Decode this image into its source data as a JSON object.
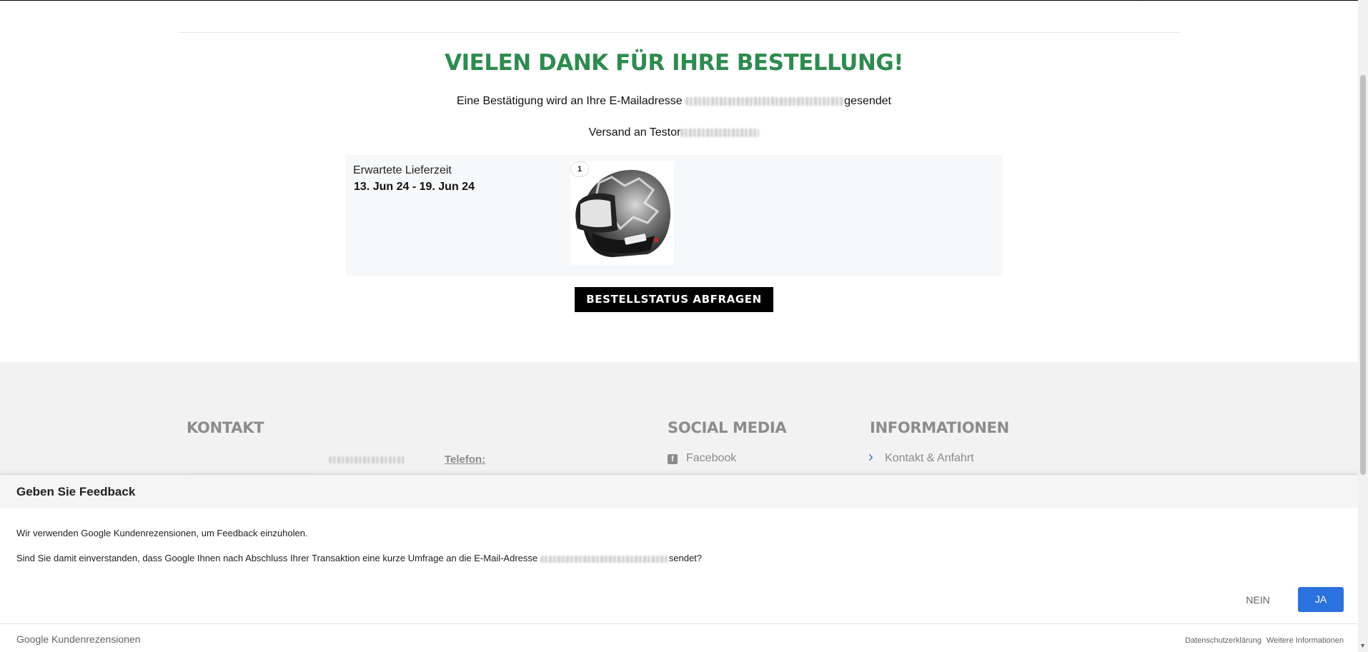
{
  "header": {
    "top_icons": [
      "person-icon",
      "cart-icon"
    ]
  },
  "confirmation": {
    "title": "VIELEN DANK FÜR IHRE BESTELLUNG!",
    "email_prefix": "Eine Bestätigung wird an Ihre E-Mailadresse",
    "email_suffix": "gesendet",
    "shipping_prefix": "Versand an Testor"
  },
  "order": {
    "delivery_label": "Erwartete Lieferzeit",
    "delivery_dates": "13. Jun 24 - 19. Jun 24",
    "item_quantity": "1",
    "status_button": "BESTELLSTATUS ABFRAGEN"
  },
  "footer": {
    "kontakt_heading": "KONTAKT",
    "phone_label": "Telefon:",
    "social_heading": "SOCIAL MEDIA",
    "facebook_label": "Facebook",
    "info_heading": "INFORMATIONEN",
    "info_link": "Kontakt & Anfahrt"
  },
  "feedback": {
    "title": "Geben Sie Feedback",
    "line1": "Wir verwenden Google Kundenrezensionen, um Feedback einzuholen.",
    "line2_prefix": "Sind Sie damit einverstanden, dass Google Ihnen nach Abschluss Ihrer Transaktion eine kurze Umfrage an die E-Mail-Adresse",
    "line2_suffix": "sendet?",
    "no_button": "NEIN",
    "yes_button": "JA",
    "brand": "Google Kundenrezensionen",
    "privacy_link": "Datenschutzerklärung",
    "more_info_link": "Weitere Informationen"
  },
  "colors": {
    "accent_green": "#2e8b4f",
    "button_black": "#000000",
    "google_blue": "#2c72de"
  }
}
